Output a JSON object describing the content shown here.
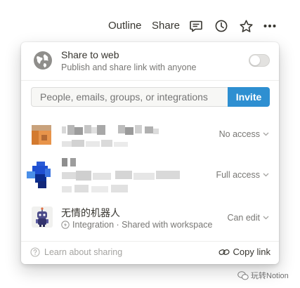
{
  "topbar": {
    "outline_label": "Outline",
    "share_label": "Share",
    "icons": [
      "comment-icon",
      "clock-icon",
      "star-icon",
      "more-icon"
    ]
  },
  "share_to_web": {
    "title": "Share to web",
    "subtitle": "Publish and share link with anyone",
    "enabled": false
  },
  "invite": {
    "placeholder": "People, emails, groups, or integrations",
    "button_label": "Invite",
    "button_color": "#2e8fd1"
  },
  "members": [
    {
      "name": "",
      "access": "No access"
    },
    {
      "name": "",
      "access": "Full access"
    },
    {
      "name": "无情的机器人",
      "subtitle": "Integration · Shared with workspace",
      "access": "Can edit"
    }
  ],
  "footer": {
    "learn_label": "Learn about sharing",
    "copy_label": "Copy link"
  },
  "watermark": {
    "text": "玩转Notion"
  }
}
